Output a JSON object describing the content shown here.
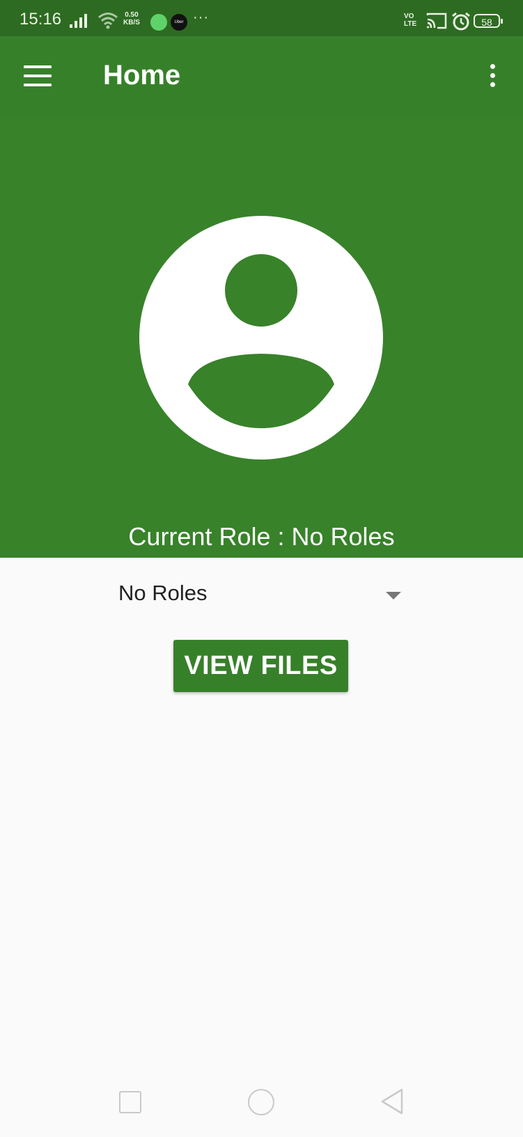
{
  "status_bar": {
    "time": "15:16",
    "speed_value": "0.50",
    "speed_unit": "KB/S",
    "uber_label": "Uber",
    "more": "···",
    "volte_top": "VO",
    "volte_bottom": "LTE",
    "battery": "58"
  },
  "app_bar": {
    "title": "Home",
    "menu_icon": "hamburger-menu-icon",
    "overflow_icon": "more-vertical-icon"
  },
  "header": {
    "avatar_icon": "account-circle-icon",
    "current_role_text": "Current Role : No Roles"
  },
  "role_spinner": {
    "selected": "No Roles"
  },
  "actions": {
    "view_files_label": "VIEW FILES"
  },
  "colors": {
    "primary": "#38822a",
    "primary_dark": "#2e6b22",
    "background": "#fafafa"
  }
}
